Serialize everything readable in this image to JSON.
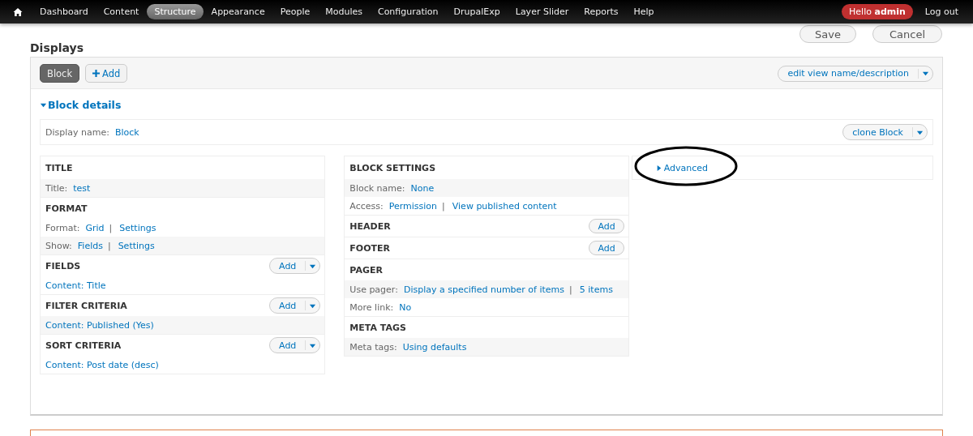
{
  "toolbar": {
    "items": [
      {
        "label": "Dashboard",
        "selected": false
      },
      {
        "label": "Content",
        "selected": false
      },
      {
        "label": "Structure",
        "selected": true
      },
      {
        "label": "Appearance",
        "selected": false
      },
      {
        "label": "People",
        "selected": false
      },
      {
        "label": "Modules",
        "selected": false
      },
      {
        "label": "Configuration",
        "selected": false
      },
      {
        "label": "DrupalExp",
        "selected": false
      },
      {
        "label": "Layer Slider",
        "selected": false
      },
      {
        "label": "Reports",
        "selected": false
      },
      {
        "label": "Help",
        "selected": false
      }
    ],
    "greeting": "Hello **admin**",
    "logout": "Log out"
  },
  "actions": [
    "Save",
    "Cancel"
  ],
  "displays": {
    "heading": "Displays",
    "tabs": [
      {
        "label": "Block",
        "kind": "display",
        "selected": true
      },
      {
        "label": "Add",
        "kind": "add",
        "selected": false
      }
    ],
    "edit_button": "edit view name/description"
  },
  "details": {
    "title": "Block details",
    "expanded": true,
    "display_name_label": "Display name:",
    "display_name": "Block",
    "clone_button": "clone Block"
  },
  "columns": [
    {
      "sections": [
        {
          "title": "TITLE",
          "rows": [
            {
              "label": "Title:",
              "links": [
                "test"
              ]
            }
          ]
        },
        {
          "title": "FORMAT",
          "rows": [
            {
              "label": "Format:",
              "links": [
                "Grid",
                "Settings"
              ],
              "separator": "|"
            },
            {
              "label": "Show:",
              "links": [
                "Fields",
                "Settings"
              ],
              "separator": "|"
            }
          ]
        },
        {
          "title": "FIELDS",
          "add_button": "Add",
          "add_menu": true,
          "rows": [
            {
              "links": [
                "Content: Title"
              ]
            }
          ]
        },
        {
          "title": "FILTER CRITERIA",
          "add_button": "Add",
          "add_menu": true,
          "rows": [
            {
              "links": [
                "Content: Published (Yes)"
              ]
            }
          ]
        },
        {
          "title": "SORT CRITERIA",
          "add_button": "Add",
          "add_menu": true,
          "rows": [
            {
              "links": [
                "Content: Post date (desc)"
              ]
            }
          ]
        }
      ]
    },
    {
      "sections": [
        {
          "title": "BLOCK SETTINGS",
          "rows": [
            {
              "label": "Block name:",
              "links": [
                "None"
              ]
            },
            {
              "label": "Access:",
              "links": [
                "Permission",
                "View published content"
              ],
              "separator": "|"
            }
          ]
        },
        {
          "title": "HEADER",
          "add_button": "Add",
          "add_menu": false
        },
        {
          "title": "FOOTER",
          "add_button": "Add",
          "add_menu": false
        },
        {
          "title": "PAGER",
          "rows": [
            {
              "label": "Use pager:",
              "links": [
                "Display a specified number of items",
                "5 items"
              ],
              "separator": "|"
            },
            {
              "label": "More link:",
              "links": [
                "No"
              ]
            }
          ]
        },
        {
          "title": "META TAGS",
          "rows": [
            {
              "label": "Meta tags:",
              "links": [
                "Using defaults"
              ]
            }
          ]
        }
      ]
    }
  ],
  "advanced": {
    "label": "Advanced",
    "expanded": false
  }
}
